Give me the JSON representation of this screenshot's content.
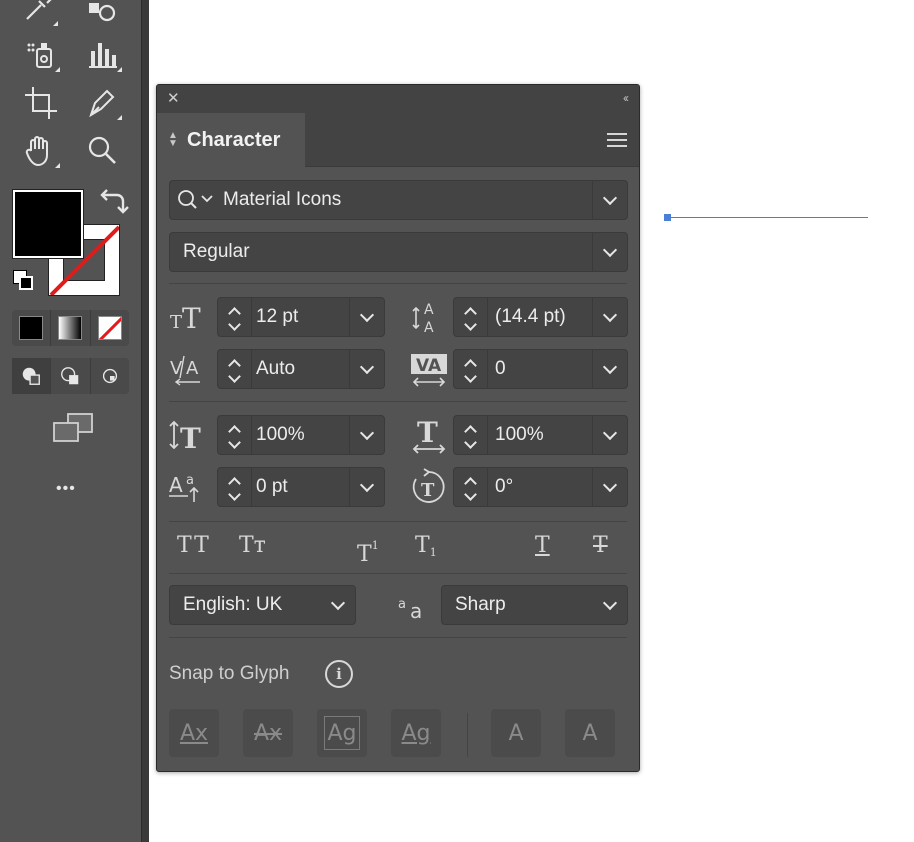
{
  "panel": {
    "close_glyph": "✕",
    "collapse_glyph": "‹‹",
    "tab_label": "Character",
    "font_family": "Material Icons",
    "font_style": "Regular",
    "font_size": "12 pt",
    "leading": "(14.4 pt)",
    "kerning": "Auto",
    "tracking": "0",
    "vertical_scale": "100%",
    "horizontal_scale": "100%",
    "baseline_shift": "0 pt",
    "rotation": "0°",
    "language": "English: UK",
    "antialiasing": "Sharp",
    "snap_label": "Snap to Glyph",
    "info_glyph": "i",
    "type_buttons": {
      "all_caps": "TT",
      "small_caps": "Tт",
      "superscript": "T",
      "superscript_mark": "1",
      "subscript": "T",
      "subscript_mark": "1",
      "underline": "T",
      "strikethrough": "T"
    },
    "snap_buttons": [
      "Ax",
      "Ax",
      "Ag",
      "Ag",
      "A",
      "A"
    ]
  },
  "toolbar": {
    "more_glyph": "•••"
  },
  "colors": {
    "panel_bg": "#535353",
    "field_bg": "#444444",
    "titlebar_bg": "#434343",
    "path_blue": "#4a7fd6",
    "stroke_none_red": "#e01b1b"
  }
}
